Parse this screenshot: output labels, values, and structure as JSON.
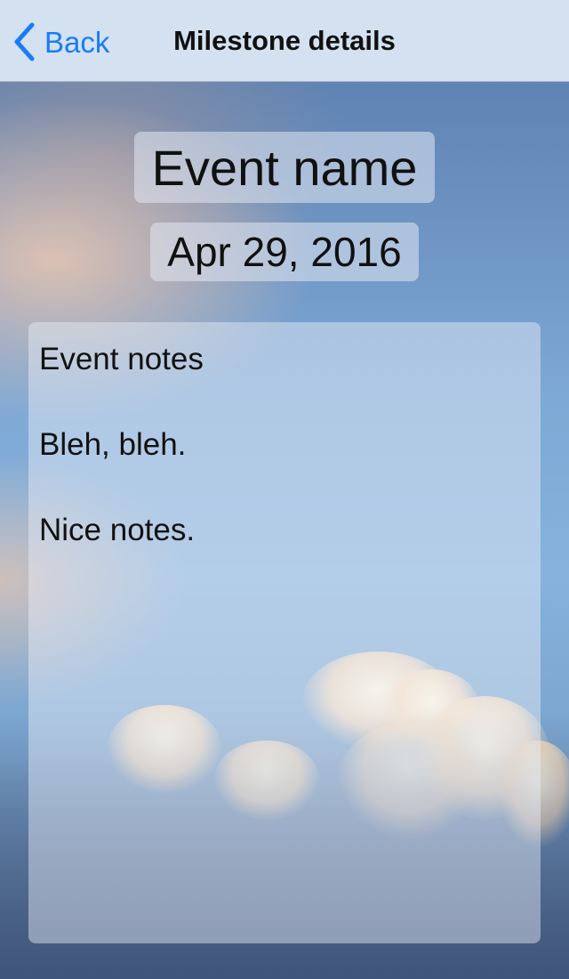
{
  "navbar": {
    "back_label": "Back",
    "title": "Milestone details",
    "accent_color": "#1a7cf5",
    "back_icon": "chevron-left-icon"
  },
  "milestone": {
    "name": "Event name",
    "date": "Apr 29, 2016",
    "notes": [
      "Event notes",
      "",
      "Bleh, bleh.",
      "",
      "Nice notes."
    ]
  },
  "background": {
    "description_icon": "sky-clouds-background"
  }
}
